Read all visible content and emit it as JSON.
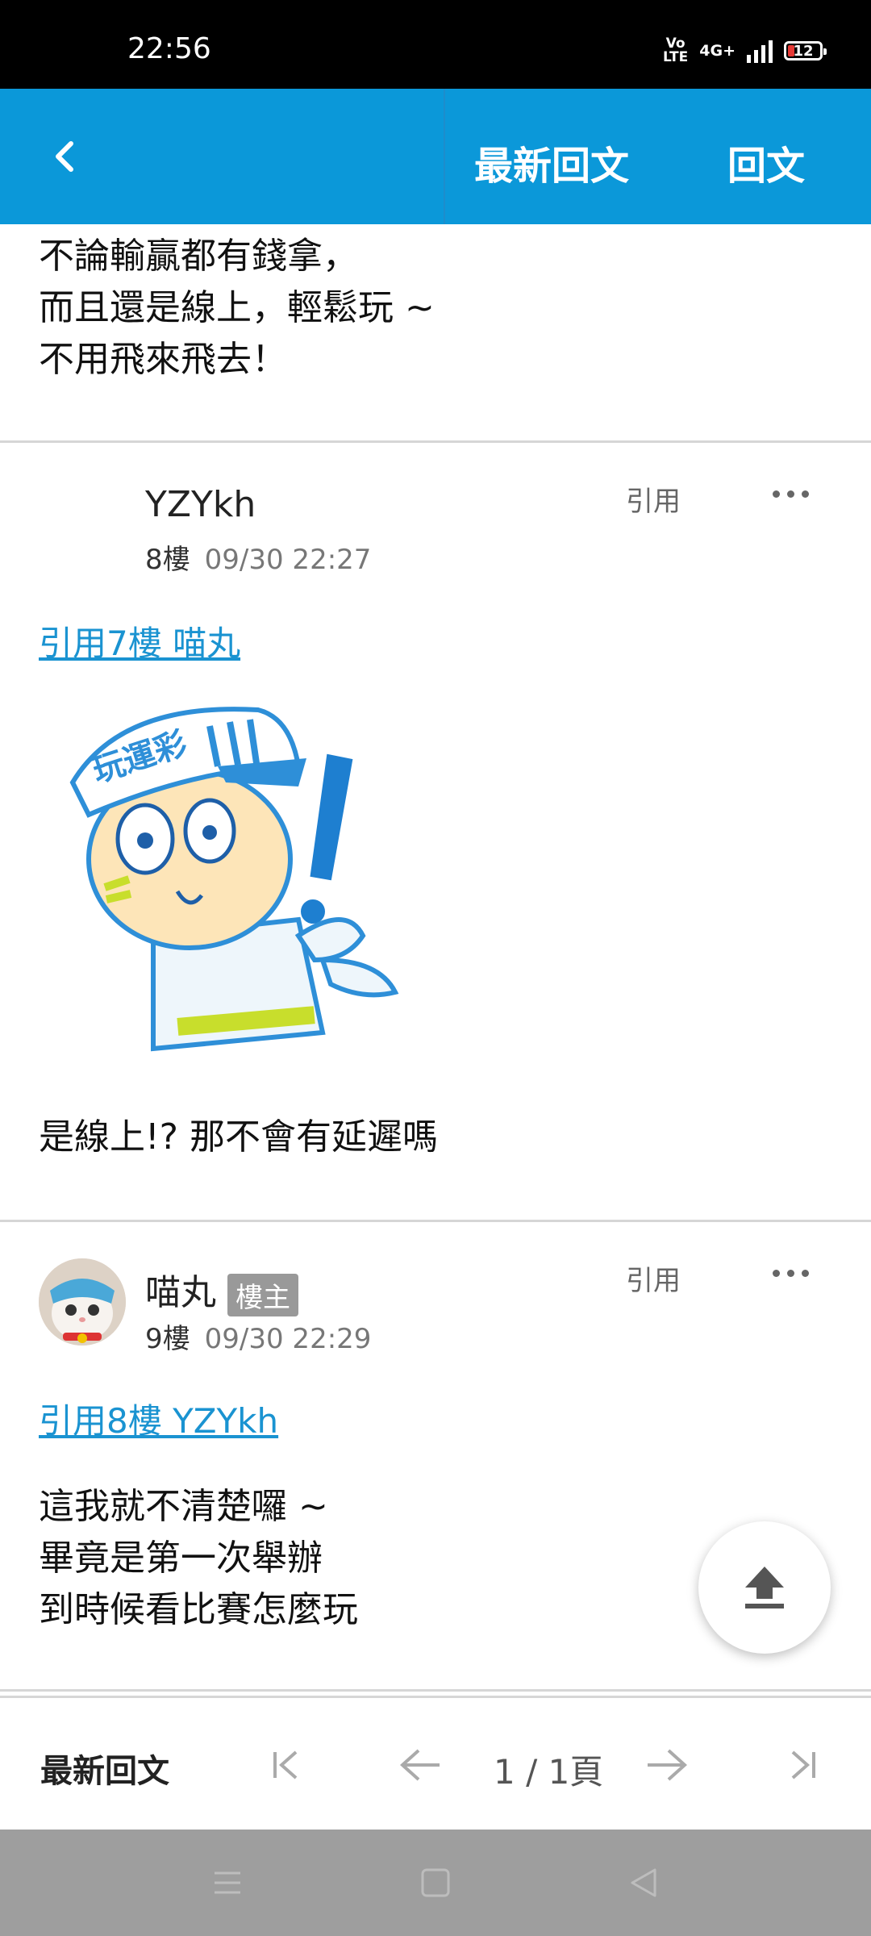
{
  "status_bar": {
    "time": "22:56",
    "volte": "Vo\nLTE",
    "network": "4G+",
    "battery": "12"
  },
  "app_bar": {
    "latest_replies": "最新回文",
    "reply": "回文"
  },
  "post7_tail": {
    "lines": [
      "不論輸贏都有錢拿，",
      "而且還是線上，輕鬆玩 ~",
      "不用飛來飛去！"
    ]
  },
  "post8": {
    "author": "YZYkh",
    "floor": "8樓",
    "time": "09/30 22:27",
    "quote_action": "引用",
    "quote_link": "引用7樓 喵丸",
    "sticker_text": "玩運彩",
    "body": "是線上!? 那不會有延遲嗎"
  },
  "post9": {
    "author": "喵丸",
    "badge": "樓主",
    "floor": "9樓",
    "time": "09/30 22:29",
    "quote_action": "引用",
    "quote_link": "引用8樓 YZYkh",
    "lines": [
      "這我就不清楚囉 ~",
      "畢竟是第一次舉辦",
      "到時候看比賽怎麼玩"
    ]
  },
  "pager": {
    "latest": "最新回文",
    "page": "1 / 1頁"
  },
  "icons": [
    "back-icon",
    "more-icon",
    "upload-icon",
    "first-page-icon",
    "prev-page-icon",
    "next-page-icon",
    "last-page-icon",
    "menu-icon",
    "home-icon",
    "back-nav-icon"
  ],
  "colors": {
    "app_bar": "#0b98d9",
    "link": "#1a93d1",
    "nav_bar": "#9e9e9e"
  }
}
